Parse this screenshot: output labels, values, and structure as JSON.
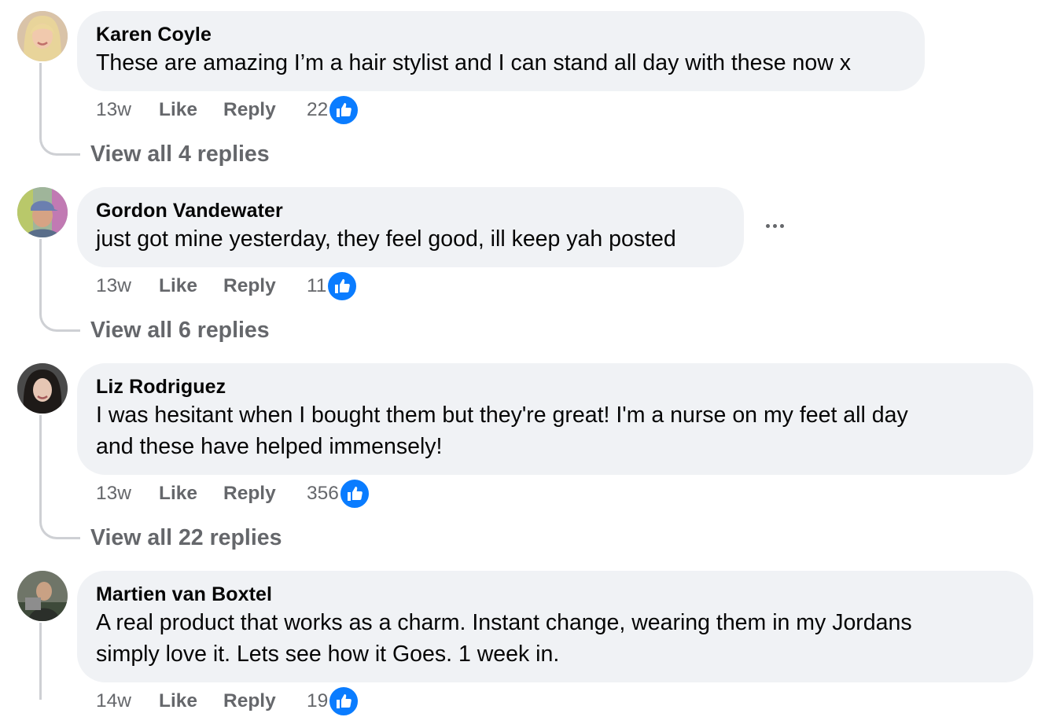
{
  "comments": [
    {
      "author": "Karen Coyle",
      "text_lines": [
        "These are amazing I’m a hair stylist and I can stand all day with these now x"
      ],
      "time": "13w",
      "like_label": "Like",
      "reply_label": "Reply",
      "reaction_count": "22",
      "view_replies": "View all 4 replies"
    },
    {
      "author": "Gordon Vandewater",
      "text_lines": [
        "just got mine yesterday, they feel good, ill keep yah posted"
      ],
      "time": "13w",
      "like_label": "Like",
      "reply_label": "Reply",
      "reaction_count": "11",
      "view_replies": "View all 6 replies"
    },
    {
      "author": "Liz Rodriguez",
      "text_lines": [
        "I was hesitant when I bought them but they're great! I'm a nurse on my feet all day",
        "and these have helped immensely!"
      ],
      "time": "13w",
      "like_label": "Like",
      "reply_label": "Reply",
      "reaction_count": "356",
      "view_replies": "View all 22 replies"
    },
    {
      "author": "Martien van Boxtel",
      "text_lines": [
        "A real product that works as a charm. Instant change, wearing them in my Jordans",
        "simply love it. Lets see how it Goes. 1 week in."
      ],
      "time": "14w",
      "like_label": "Like",
      "reply_label": "Reply",
      "reaction_count": "19"
    }
  ],
  "icons": {
    "reaction": "thumbs-up-icon",
    "more": "more-options-icon"
  },
  "colors": {
    "bubble": "#f0f2f5",
    "like_blue": "#0a7cff",
    "secondary_text": "#65676b"
  }
}
